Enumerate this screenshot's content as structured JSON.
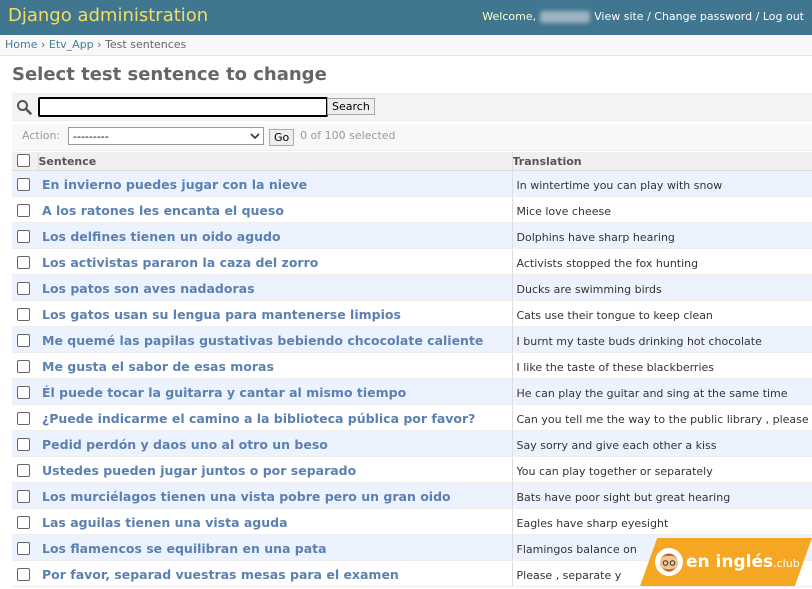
{
  "header": {
    "brand": "Django administration",
    "welcome": "Welcome,",
    "view_site": "View site",
    "change_password": "Change password",
    "log_out": "Log out",
    "separator": " / "
  },
  "breadcrumbs": {
    "home": "Home",
    "app": "Etv_App",
    "current": "Test sentences",
    "sep": " › "
  },
  "page": {
    "title": "Select test sentence to change"
  },
  "search": {
    "value": "",
    "button": "Search"
  },
  "actions": {
    "label": "Action:",
    "selected_option": "---------",
    "go_button": "Go",
    "selected_count": "0 of 100 selected"
  },
  "table": {
    "columns": [
      "Sentence",
      "Translation"
    ],
    "rows": [
      {
        "sentence": "En invierno puedes jugar con la nieve",
        "translation": "In wintertime you can play with snow"
      },
      {
        "sentence": "A los ratones les encanta el queso",
        "translation": "Mice love cheese"
      },
      {
        "sentence": "Los delfines tienen un oido agudo",
        "translation": "Dolphins have sharp hearing"
      },
      {
        "sentence": "Los activistas pararon la caza del zorro",
        "translation": "Activists stopped the fox hunting"
      },
      {
        "sentence": "Los patos son aves nadadoras",
        "translation": "Ducks are swimming birds"
      },
      {
        "sentence": "Los gatos usan su lengua para mantenerse limpios",
        "translation": "Cats use their tongue to keep clean"
      },
      {
        "sentence": "Me quemé las papilas gustativas bebiendo chcocolate caliente",
        "translation": "I burnt my taste buds drinking hot chocolate"
      },
      {
        "sentence": "Me gusta el sabor de esas moras",
        "translation": "I like the taste of these blackberries"
      },
      {
        "sentence": "Él puede tocar la guitarra y cantar al mismo tiempo",
        "translation": "He can play the guitar and sing at the same time"
      },
      {
        "sentence": "¿Puede indicarme el camino a la biblioteca pública por favor?",
        "translation": "Can you tell me the way to the public library , please"
      },
      {
        "sentence": "Pedid perdón y daos uno al otro un beso",
        "translation": "Say sorry and give each other a kiss"
      },
      {
        "sentence": "Ustedes pueden jugar juntos o por separado",
        "translation": "You can play together or separately"
      },
      {
        "sentence": "Los murciélagos tienen una vista pobre pero un gran oido",
        "translation": "Bats have poor sight but great hearing"
      },
      {
        "sentence": "Las aguilas tienen una vista aguda",
        "translation": "Eagles have sharp eyesight"
      },
      {
        "sentence": "Los flamencos se equilibran en una pata",
        "translation": "Flamingos balance on"
      },
      {
        "sentence": "Por favor, separad vuestras mesas para el examen",
        "translation": "Please , separate y"
      }
    ]
  },
  "watermark": {
    "text": "en inglés",
    "suffix": ".club"
  },
  "colors": {
    "header_bg": "#417690",
    "brand": "#f5dd5d",
    "link": "#5b80b2",
    "row_alt": "#edf3fe",
    "watermark": "#f5a623"
  }
}
